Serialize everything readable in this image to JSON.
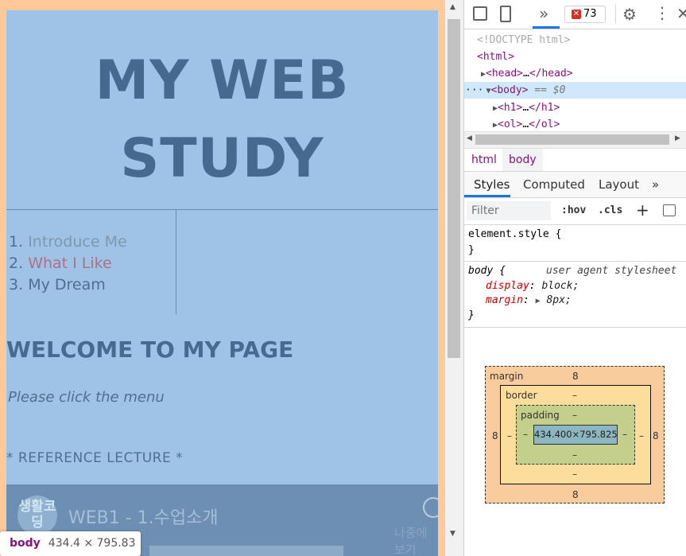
{
  "page": {
    "title_line1": "MY WEB",
    "title_line2": "STUDY",
    "menu": [
      {
        "num": "1.",
        "label": "Introduce Me"
      },
      {
        "num": "2.",
        "label": "What I Like"
      },
      {
        "num": "3.",
        "label": "My Dream"
      }
    ],
    "welcome": "WELCOME TO MY PAGE",
    "instruction": "Please click the menu",
    "reference": "* REFERENCE LECTURE *",
    "video": {
      "logo_text": "생활코딩",
      "title": "WEB1 - 1.수업소개",
      "watch_later": "나중에 보기"
    }
  },
  "inspect_badge": {
    "tag": "body",
    "size": "434.4 × 795.83"
  },
  "devtools": {
    "toolbar": {
      "more_label": "»",
      "error_count": "73",
      "gear_icon": "gear-icon",
      "kebab_icon": "kebab-icon",
      "close_label": "✕"
    },
    "dom": {
      "doctype": "<!DOCTYPE html>",
      "html_open": "<html>",
      "head_tag": "<head>",
      "head_ellipsis": "…",
      "head_close": "</head>",
      "body_tag": "<body>",
      "body_marker": " == $0",
      "h1_tag": "<h1>",
      "h1_ellipsis": "…",
      "h1_close": "</h1>",
      "ol_tag": "<ol>",
      "ol_ellipsis": "…",
      "ol_close": "</ol>",
      "more_dots": "···"
    },
    "breadcrumbs": [
      "html",
      "body"
    ],
    "style_tabs": [
      "Styles",
      "Computed",
      "Layout",
      "»"
    ],
    "filter_placeholder": "Filter",
    "hov_label": ":hov",
    "cls_label": ".cls",
    "plus_label": "+",
    "rules": {
      "element_style_open": "element.style {",
      "element_style_close": "}",
      "body_selector": "body {",
      "body_source": "user agent stylesheet",
      "prop1_name": "display",
      "prop1_value": "block;",
      "prop2_name": "margin",
      "prop2_value": "8px;",
      "body_close": "}"
    },
    "box_model": {
      "margin_label": "margin",
      "margin_top": "8",
      "margin_bottom": "8",
      "margin_left": "8",
      "margin_right": "8",
      "border_label": "border",
      "border_top": "–",
      "border_bottom": "–",
      "border_left": "–",
      "border_right": "–",
      "padding_label": "padding",
      "padding_top": "–",
      "padding_bottom": "–",
      "padding_left": "–",
      "padding_right": "–",
      "content_size": "434.400×795.825"
    }
  }
}
